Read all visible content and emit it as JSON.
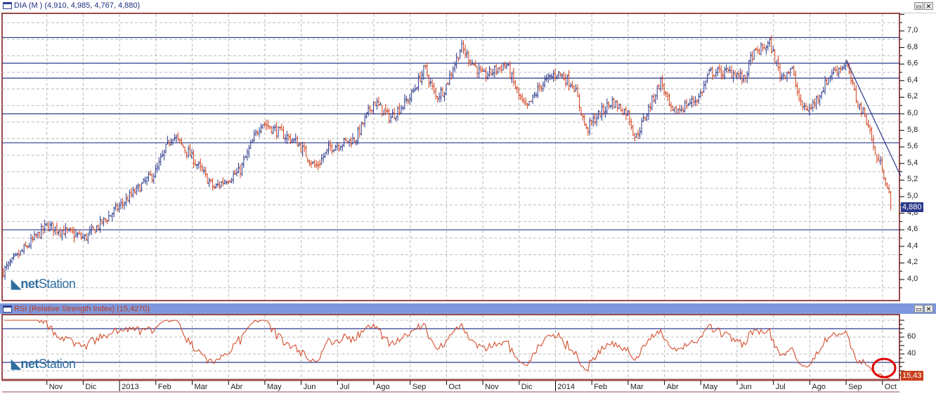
{
  "main_panel": {
    "title": "DIA (M ) (4,910, 4,985, 4,767, 4,880)",
    "last_value": "4,880",
    "logo_text_bold": "net",
    "logo_text": "Station"
  },
  "rsi_panel": {
    "title": "RSI (Relative Strength Index) (15,4270)",
    "last_value": "15,43",
    "logo_text_bold": "net",
    "logo_text": "Station"
  },
  "window_buttons": {
    "restore": "▭",
    "close": "✕"
  },
  "colors": {
    "up": "#2b3a8c",
    "down": "#d2401c",
    "axis": "#9a4a4a",
    "hline": "#2b3a8c",
    "rsi": "#d2401c",
    "highlight": "#e00000"
  },
  "chart_data": {
    "type": "bar",
    "price": {
      "yaxis_ticks": [
        "7,0",
        "6,8",
        "6,6",
        "6,4",
        "6,2",
        "6,0",
        "5,8",
        "5,6",
        "5,4",
        "5,2",
        "5,0",
        "4,8",
        "4,6",
        "4,4",
        "4,2",
        "4,0"
      ],
      "ylim": [
        3.85,
        7.2
      ],
      "horizontal_levels": [
        6.92,
        6.61,
        6.43,
        6.0,
        5.65,
        4.6
      ],
      "trendline": [
        [
          23.0,
          6.65
        ],
        [
          24.5,
          5.25
        ]
      ],
      "points": [
        [
          -0.2,
          4.1
        ],
        [
          1.0,
          4.65
        ],
        [
          2.05,
          4.5
        ],
        [
          3.04,
          4.9
        ],
        [
          4.0,
          5.3
        ],
        [
          4.45,
          5.75
        ],
        [
          4.95,
          5.5
        ],
        [
          5.6,
          5.1
        ],
        [
          5.9,
          5.2
        ],
        [
          6.3,
          5.3
        ],
        [
          6.9,
          5.9
        ],
        [
          7.9,
          5.65
        ],
        [
          8.4,
          5.35
        ],
        [
          8.8,
          5.6
        ],
        [
          9.5,
          5.7
        ],
        [
          10.0,
          6.15
        ],
        [
          10.45,
          5.95
        ],
        [
          11.0,
          6.2
        ],
        [
          11.4,
          6.55
        ],
        [
          11.7,
          6.2
        ],
        [
          11.95,
          6.3
        ],
        [
          12.4,
          6.8
        ],
        [
          13.0,
          6.45
        ],
        [
          13.65,
          6.6
        ],
        [
          14.0,
          6.2
        ],
        [
          14.2,
          6.05
        ],
        [
          14.6,
          6.35
        ],
        [
          15.05,
          6.5
        ],
        [
          15.5,
          6.35
        ],
        [
          15.85,
          5.8
        ],
        [
          16.0,
          5.9
        ],
        [
          16.55,
          6.15
        ],
        [
          17.0,
          6.0
        ],
        [
          17.2,
          5.7
        ],
        [
          17.9,
          6.4
        ],
        [
          18.2,
          6.0
        ],
        [
          18.95,
          6.2
        ],
        [
          19.25,
          6.5
        ],
        [
          19.95,
          6.5
        ],
        [
          20.2,
          6.4
        ],
        [
          20.4,
          6.7
        ],
        [
          20.9,
          6.85
        ],
        [
          21.2,
          6.45
        ],
        [
          21.5,
          6.55
        ],
        [
          21.75,
          6.1
        ],
        [
          22.0,
          6.05
        ],
        [
          22.35,
          6.3
        ],
        [
          22.6,
          6.5
        ],
        [
          23.0,
          6.6
        ],
        [
          23.3,
          6.15
        ],
        [
          23.6,
          5.9
        ],
        [
          23.8,
          5.5
        ],
        [
          24.0,
          5.35
        ],
        [
          24.25,
          4.88
        ]
      ]
    },
    "rsi": {
      "yaxis_ticks": [
        "60",
        "40"
      ],
      "ylim": [
        5,
        85
      ],
      "levels": [
        70,
        30
      ],
      "period": 14
    },
    "x_labels": [
      "Nov",
      "Dic",
      "2013",
      "Feb",
      "Mar",
      "Abr",
      "May",
      "Jun",
      "Jul",
      "Ago",
      "Sep",
      "Oct",
      "Nov",
      "Dic",
      "2014",
      "Feb",
      "Mar",
      "Abr",
      "May",
      "Jun",
      "Jul",
      "Ago",
      "Sep",
      "Oct"
    ]
  }
}
